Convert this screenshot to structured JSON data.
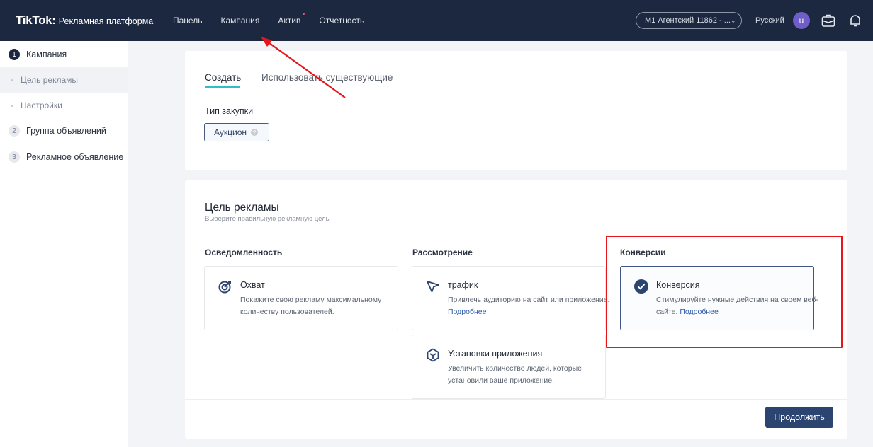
{
  "header": {
    "brand_logo": "TikTok",
    "brand_colon": ":",
    "brand_subtitle": "Рекламная платформа",
    "nav": [
      {
        "label": "Панель"
      },
      {
        "label": "Кампания"
      },
      {
        "label": "Актив"
      },
      {
        "label": "Отчетность"
      }
    ],
    "account_label": "M1 Агентский 11862 - ...",
    "language": "Русский",
    "avatar_letter": "u"
  },
  "sidebar": {
    "steps": [
      {
        "number": "1",
        "label": "Кампания"
      },
      {
        "number": "2",
        "label": "Группа объявлений"
      },
      {
        "number": "3",
        "label": "Рекламное объявление"
      }
    ],
    "substeps": [
      {
        "label": "Цель рекламы"
      },
      {
        "label": "Настройки"
      }
    ]
  },
  "purchase": {
    "tabs": [
      {
        "label": "Создать"
      },
      {
        "label": "Использовать существующие"
      }
    ],
    "type_label": "Тип закупки",
    "type_value": "Аукцион"
  },
  "objective": {
    "title": "Цель рекламы",
    "subtitle": "Выберите правильную рекламную цель",
    "columns": [
      {
        "title": "Осведомленность"
      },
      {
        "title": "Рассмотрение"
      },
      {
        "title": "Конверсии"
      }
    ],
    "options": {
      "reach": {
        "title": "Охват",
        "desc": "Покажите свою рекламу максимальному количеству пользователей."
      },
      "traffic": {
        "title": "трафик",
        "desc": "Привлечь аудиторию на сайт или приложение.",
        "link": "Подробнее"
      },
      "app_installs": {
        "title": "Установки приложения",
        "desc": "Увеличить количество людей, которые установили ваше приложение."
      },
      "conversion": {
        "title": "Конверсия",
        "desc": "Стимулируйте нужные действия на своем веб-сайте.",
        "link": "Подробнее"
      }
    }
  },
  "footer": {
    "continue_label": "Продолжить"
  },
  "colors": {
    "topbar": "#1c2740",
    "accent": "#2fbfc8",
    "primary_button": "#2b4470",
    "highlight_box": "#e4161c"
  }
}
